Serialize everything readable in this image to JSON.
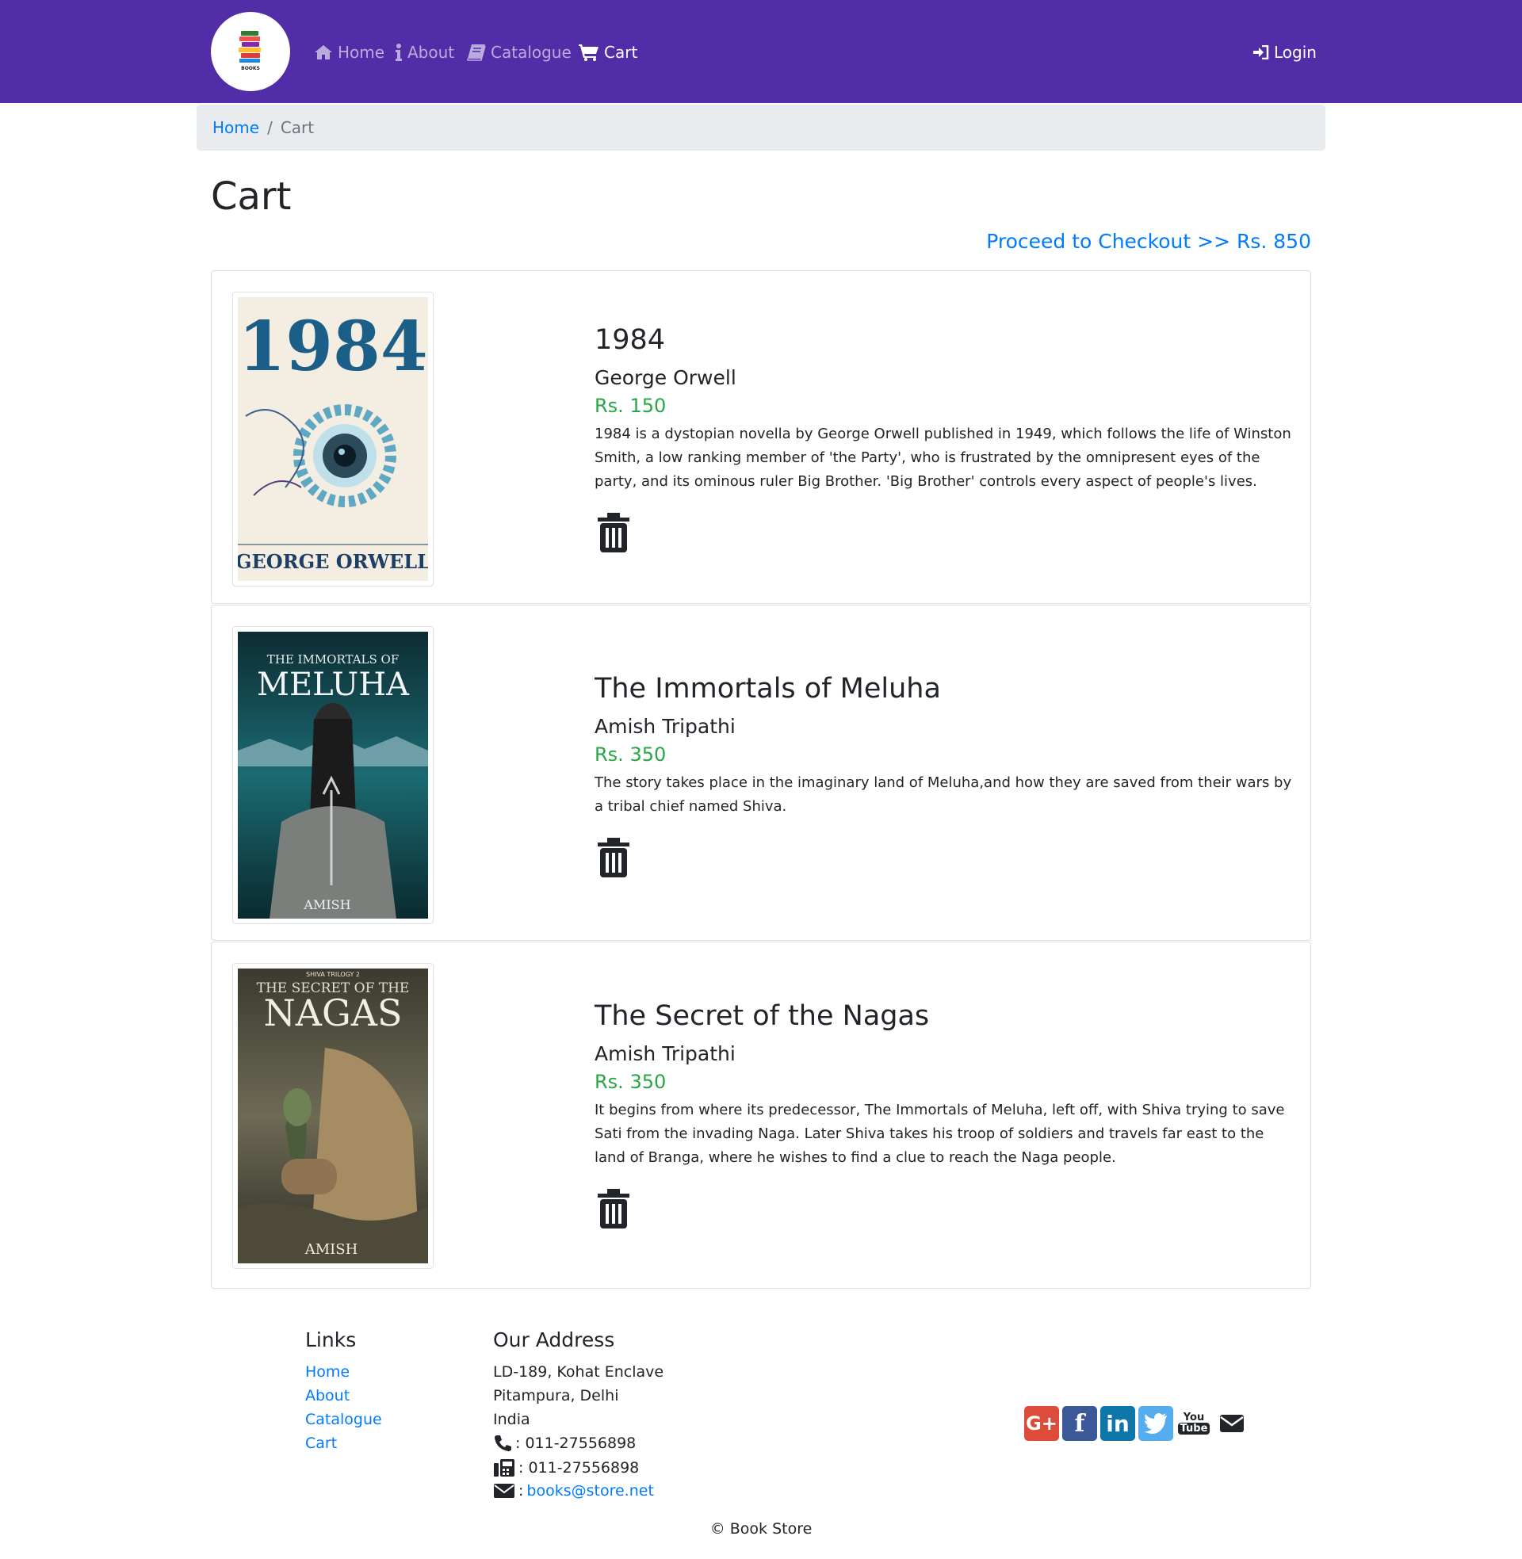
{
  "nav": {
    "logo_text": "BOOKS",
    "home": "Home",
    "about": "About",
    "catalogue": "Catalogue",
    "cart": "Cart",
    "login": "Login"
  },
  "breadcrumb": {
    "home": "Home",
    "separator": "/",
    "current": "Cart"
  },
  "page": {
    "title": "Cart",
    "checkout": "Proceed to Checkout >> Rs. 850"
  },
  "items": [
    {
      "title": "1984",
      "author": "George Orwell",
      "price": "Rs. 150",
      "description": "1984 is a dystopian novella by George Orwell published in 1949, which follows the life of Winston Smith, a low ranking member of 'the Party', who is frustrated by the omnipresent eyes of the party, and its ominous ruler Big Brother. 'Big Brother' controls every aspect of people's lives.",
      "cover_title": "1984",
      "cover_author": "GEORGE ORWELL"
    },
    {
      "title": "The Immortals of Meluha",
      "author": "Amish Tripathi",
      "price": "Rs. 350",
      "description": "The story takes place in the imaginary land of Meluha,and how they are saved from their wars by a tribal chief named Shiva.",
      "cover_subtitle": "THE IMMORTALS OF",
      "cover_title": "MELUHA",
      "cover_author": "AMISH"
    },
    {
      "title": "The Secret of the Nagas",
      "author": "Amish Tripathi",
      "price": "Rs. 350",
      "description": "It begins from where its predecessor, The Immortals of Meluha, left off, with Shiva trying to save Sati from the invading Naga. Later Shiva takes his troop of soldiers and travels far east to the land of Branga, where he wishes to find a clue to reach the Naga people.",
      "cover_series": "SHIVA TRILOGY 2",
      "cover_subtitle": "THE SECRET OF THE",
      "cover_title": "NAGAS",
      "cover_author": "AMISH"
    }
  ],
  "footer": {
    "links_heading": "Links",
    "links": [
      "Home",
      "About",
      "Catalogue",
      "Cart"
    ],
    "address_heading": "Our Address",
    "address_line1": "LD-189, Kohat Enclave",
    "address_line2": "Pitampura, Delhi",
    "address_line3": "India",
    "phone": ": 011-27556898",
    "fax": ": 011-27556898",
    "email_prefix": ":",
    "email": "books@store.net",
    "social": {
      "google": "G+",
      "facebook": "f",
      "linkedin": "in",
      "youtube_top": "You",
      "youtube_bottom": "Tube"
    },
    "copyright": "© Book Store"
  },
  "colors": {
    "navbar": "#512da8",
    "link": "#007bff",
    "price": "#28a745",
    "breadcrumb_bg": "#e9ecef",
    "google": "#dd4b39",
    "facebook": "#3b5998",
    "linkedin": "#0e76a8",
    "twitter": "#55acee"
  },
  "icons": {
    "home": "home-icon",
    "about": "info-icon",
    "catalogue": "book-icon",
    "cart": "shopping-cart-icon",
    "login": "sign-in-icon",
    "remove": "trash-icon",
    "phone": "phone-icon",
    "fax": "fax-icon",
    "email": "envelope-icon"
  }
}
